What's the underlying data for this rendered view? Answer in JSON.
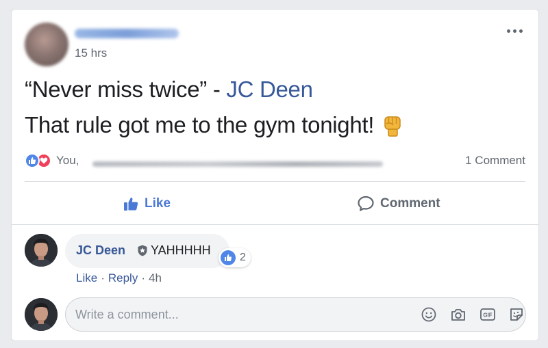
{
  "post": {
    "time": "15 hrs",
    "quote_open": "“Never miss twice” - ",
    "quote_author": "JC Deen",
    "line2": "That rule got me to the gym tonight!"
  },
  "reactions": {
    "prefix": "You,",
    "comment_count": "1 Comment"
  },
  "actions": {
    "like_label": "Like",
    "comment_label": "Comment"
  },
  "comment": {
    "author": "JC Deen",
    "text": "YAHHHHH",
    "reaction_count": "2",
    "like_link": "Like",
    "reply_link": "Reply",
    "sep": "·",
    "age": "4h"
  },
  "composer": {
    "placeholder": "Write a comment..."
  },
  "colors": {
    "link_blue": "#385898",
    "like_blue": "#4a79d6",
    "love_red": "#f0405a"
  },
  "icons": [
    "more-icon",
    "fist-emoji-icon",
    "like-reaction-icon",
    "love-reaction-icon",
    "thumbs-up-icon",
    "speech-bubble-icon",
    "verified-badge-icon",
    "emoji-icon",
    "camera-icon",
    "gif-icon",
    "sticker-icon"
  ]
}
